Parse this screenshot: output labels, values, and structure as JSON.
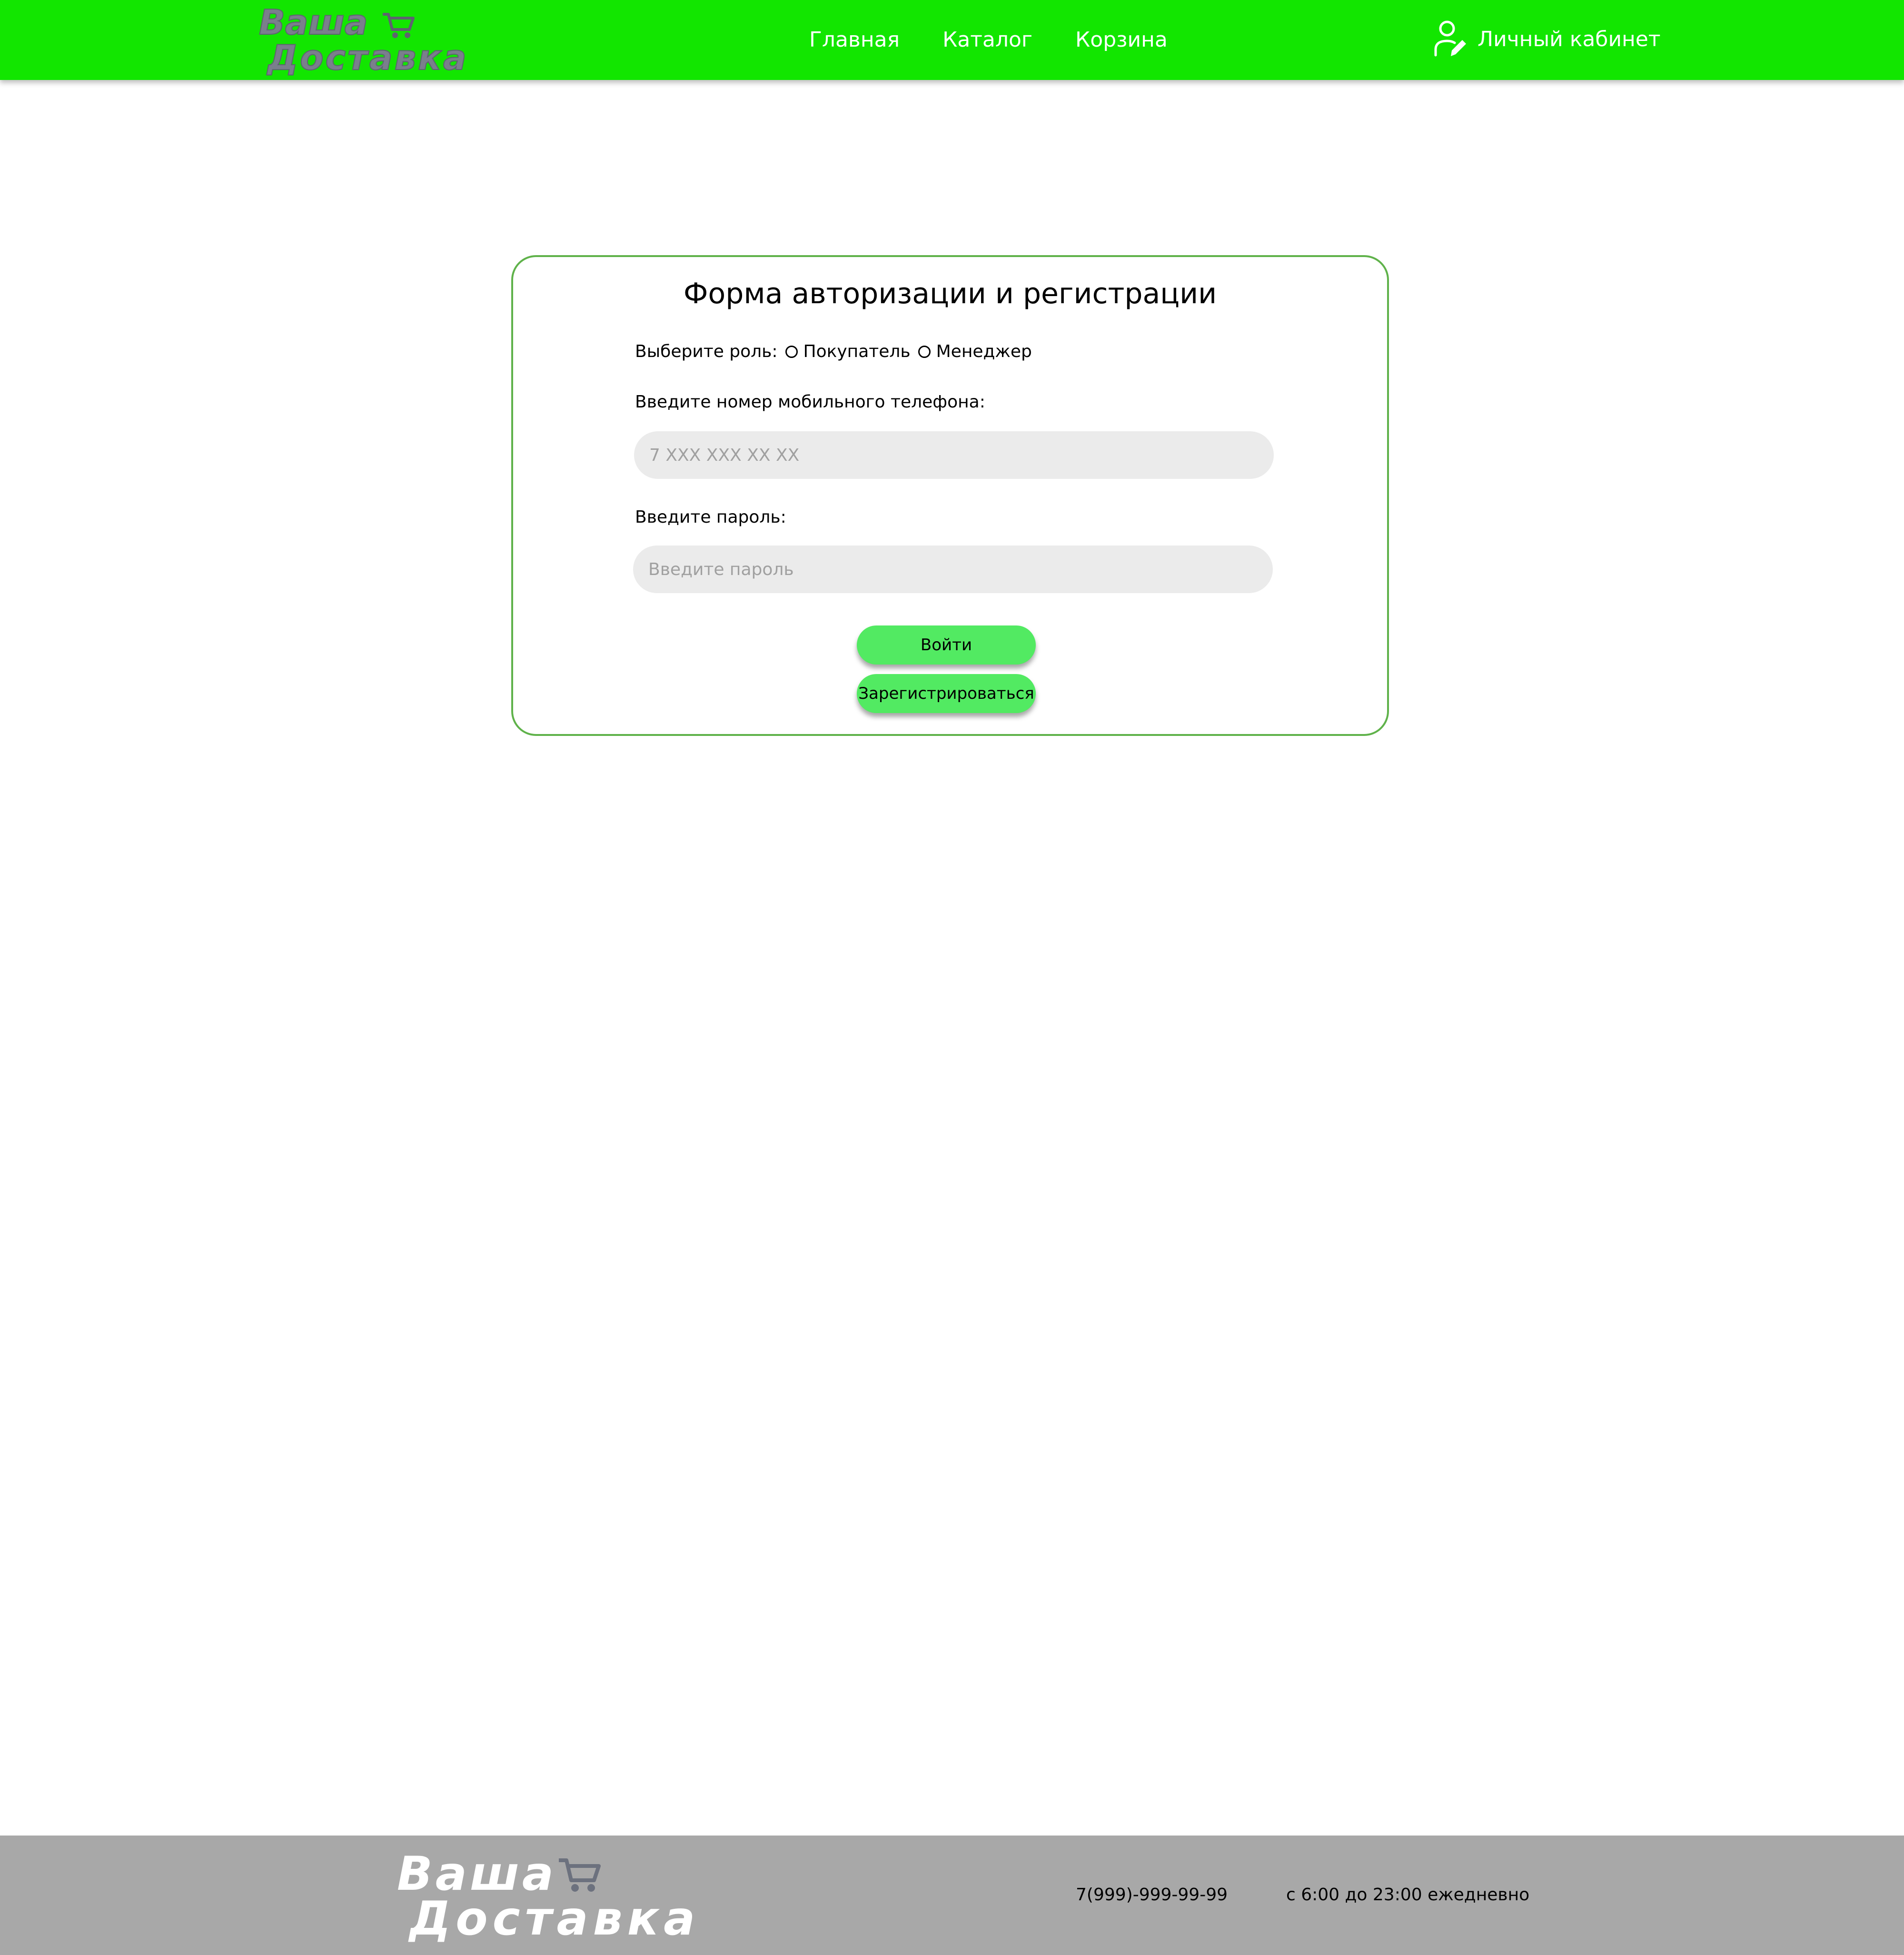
{
  "header": {
    "logo": {
      "line1": "Ваша",
      "line2": "Доставка",
      "icon": "cart-icon"
    },
    "nav": [
      {
        "label": "Главная"
      },
      {
        "label": "Каталог"
      },
      {
        "label": "Корзина"
      }
    ],
    "account": {
      "label": "Личный кабинет",
      "icon": "user-edit-icon"
    }
  },
  "form": {
    "title": "Форма авторизации и регистрации",
    "role_label": "Выберите роль:",
    "roles": [
      {
        "label": "Покупатель",
        "checked": false
      },
      {
        "label": "Менеджер",
        "checked": false
      }
    ],
    "phone_label": "Введите номер мобильного телефона:",
    "phone_placeholder": "7 XXX XXX XX XX",
    "password_label": "Введите пароль:",
    "password_placeholder": "Введите пароль",
    "login_button": "Войти",
    "register_button": "Зарегистрироваться"
  },
  "footer": {
    "logo": {
      "line1": "Ваша",
      "line2": "Доставка",
      "icon": "cart-icon"
    },
    "phone": "7(999)-999-99-99",
    "hours": "с 6:00 до 23:00 ежедневно"
  },
  "colors": {
    "header_bg": "#12e600",
    "card_border": "#5fb24a",
    "button_bg": "#52ea62",
    "input_bg": "#ebebeb",
    "footer_bg": "#a8a8a8",
    "logo_header": "#7a7f8c",
    "logo_footer": "#ffffff"
  }
}
